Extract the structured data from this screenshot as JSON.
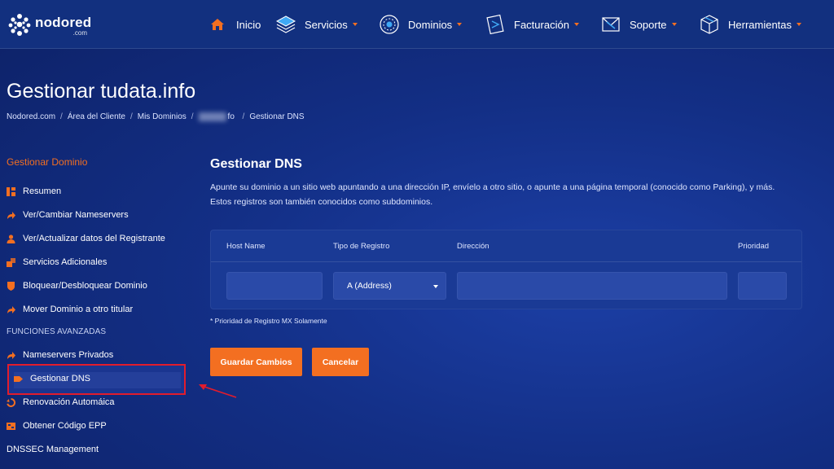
{
  "brand": {
    "name": "nodored",
    "domain_suffix": ".com"
  },
  "nav": {
    "items": [
      {
        "label": "Inicio",
        "icon": "home-icon"
      },
      {
        "label": "Servicios",
        "icon": "layers-icon"
      },
      {
        "label": "Dominios",
        "icon": "globe-icon"
      },
      {
        "label": "Facturación",
        "icon": "invoice-icon"
      },
      {
        "label": "Soporte",
        "icon": "support-icon"
      },
      {
        "label": "Herramientas",
        "icon": "box-icon"
      }
    ]
  },
  "page": {
    "title": "Gestionar tudata.info"
  },
  "breadcrumb": {
    "items": [
      "Nodored.com",
      "Área del Cliente",
      "Mis Dominios"
    ],
    "domain_partial": "fo",
    "current": "Gestionar DNS",
    "separator": "/"
  },
  "sidebar": {
    "heading": "Gestionar Dominio",
    "items": [
      {
        "label": "Resumen",
        "icon": "summary-icon"
      },
      {
        "label": "Ver/Cambiar Nameservers",
        "icon": "arrow-icon"
      },
      {
        "label": "Ver/Actualizar datos del Registrante",
        "icon": "user-icon"
      },
      {
        "label": "Servicios Adicionales",
        "icon": "addons-icon"
      },
      {
        "label": "Bloquear/Desbloquear Dominio",
        "icon": "shield-icon"
      },
      {
        "label": "Mover Dominio a otro titular",
        "icon": "arrow-icon"
      }
    ],
    "advanced_heading": "FUNCIONES AVANZADAS",
    "advanced_items": [
      {
        "label": "Nameservers Privados",
        "icon": "arrow-icon"
      },
      {
        "label": "Gestionar DNS",
        "icon": "tag-icon",
        "active": true
      },
      {
        "label": "Renovación Automáica",
        "icon": "refresh-icon"
      },
      {
        "label": "Obtener Código EPP",
        "icon": "code-icon"
      },
      {
        "label": "DNSSEC Management",
        "icon": ""
      }
    ]
  },
  "main": {
    "title": "Gestionar DNS",
    "description_line1": "Apunte su dominio a un sitio web apuntando a una dirección IP, envíelo a otro sitio, o apunte a una página temporal (conocido como Parking), y más.",
    "description_line2": "Estos registros son también conocidos como subdominios.",
    "table": {
      "headers": [
        "Host Name",
        "Tipo de Registro",
        "Dirección",
        "Prioridad"
      ],
      "row": {
        "host": "",
        "type": "A (Address)",
        "address": "",
        "priority": ""
      }
    },
    "note": "* Prioridad de Registro MX Solamente",
    "save_label": "Guardar Cambios",
    "cancel_label": "Cancelar"
  },
  "colors": {
    "accent": "#f36f21",
    "highlight": "#e21c2c",
    "background": "#132f86"
  }
}
